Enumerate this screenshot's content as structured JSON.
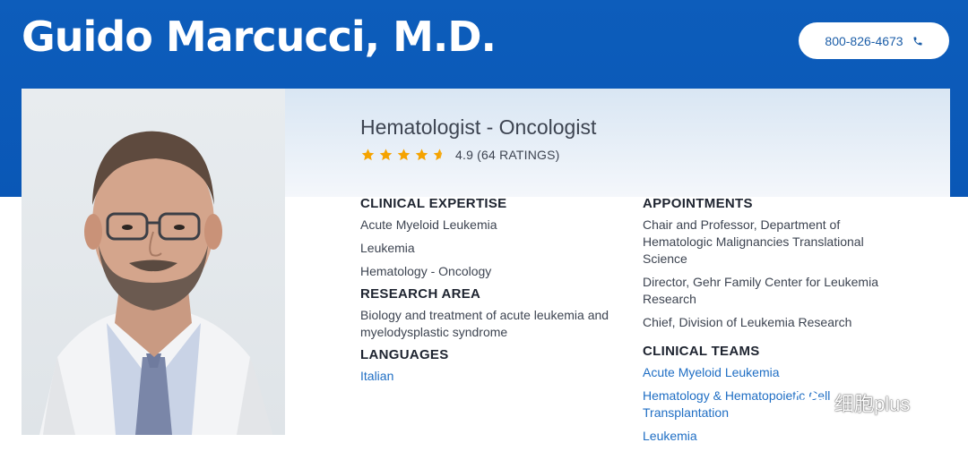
{
  "header": {
    "doctor_name": "Guido Marcucci, M.D.",
    "phone": "800-826-4673",
    "phone_icon": "phone-icon"
  },
  "profile": {
    "photo_alt": "Doctor portrait",
    "specialty": "Hematologist - Oncologist",
    "rating": {
      "value": 4.9,
      "max": 5,
      "text": "4.9 (64 RATINGS)",
      "star_color": "#f5a300"
    }
  },
  "clinical_expertise": {
    "heading": "CLINICAL EXPERTISE",
    "items": [
      "Acute Myeloid Leukemia",
      "Leukemia",
      "Hematology - Oncology"
    ]
  },
  "research_area": {
    "heading": "RESEARCH AREA",
    "text": "Biology and treatment of acute leukemia and myelodysplastic syndrome"
  },
  "languages": {
    "heading": "LANGUAGES",
    "items": [
      "Italian"
    ]
  },
  "appointments": {
    "heading": "APPOINTMENTS",
    "items": [
      "Chair and Professor, Department of Hematologic Malignancies Translational Science",
      "Director, Gehr Family Center for Leukemia Research",
      "Chief, Division of Leukemia Research"
    ]
  },
  "clinical_teams": {
    "heading": "CLINICAL TEAMS",
    "items": [
      "Acute Myeloid Leukemia",
      "Hematology & Hematopoietic Cell Transplantation",
      "Leukemia"
    ]
  },
  "watermark": {
    "text": "细胞plus",
    "icon": "wechat-icon"
  },
  "colors": {
    "brand_blue": "#0a57b6",
    "link_blue": "#1f6ec4",
    "text_dark": "#3d4451"
  }
}
